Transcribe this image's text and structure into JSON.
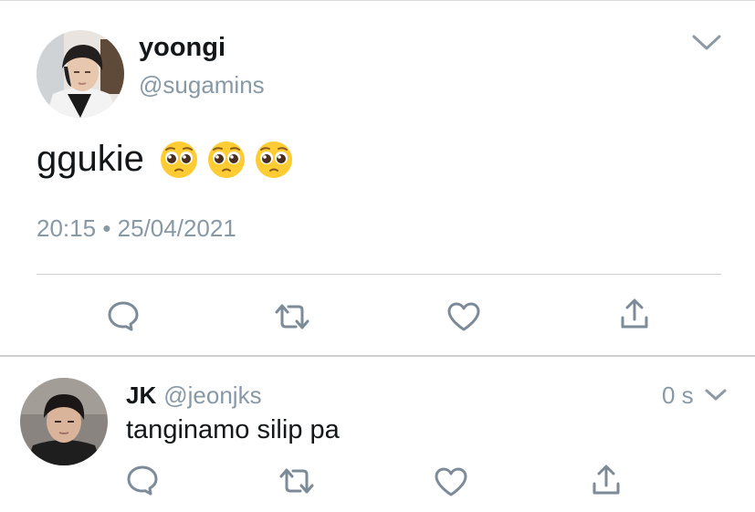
{
  "tweet": {
    "author_name": "yoongi",
    "author_handle": "@sugamins",
    "text": "ggukie",
    "emoji": [
      "pleading-face",
      "pleading-face",
      "pleading-face"
    ],
    "time": "20:15",
    "separator": "•",
    "date": "25/04/2021",
    "actions": [
      "reply-icon",
      "retweet-icon",
      "like-icon",
      "share-icon"
    ]
  },
  "reply": {
    "author_name": "JK",
    "author_handle": "@jeonjks",
    "time": "0 s",
    "text": "tanginamo silip pa",
    "actions": [
      "reply-icon",
      "retweet-icon",
      "like-icon",
      "share-icon"
    ]
  },
  "colors": {
    "text": "#14171a",
    "secondary": "#8899a6",
    "divider": "#d0d0d0",
    "icon": "#7d8b99"
  }
}
